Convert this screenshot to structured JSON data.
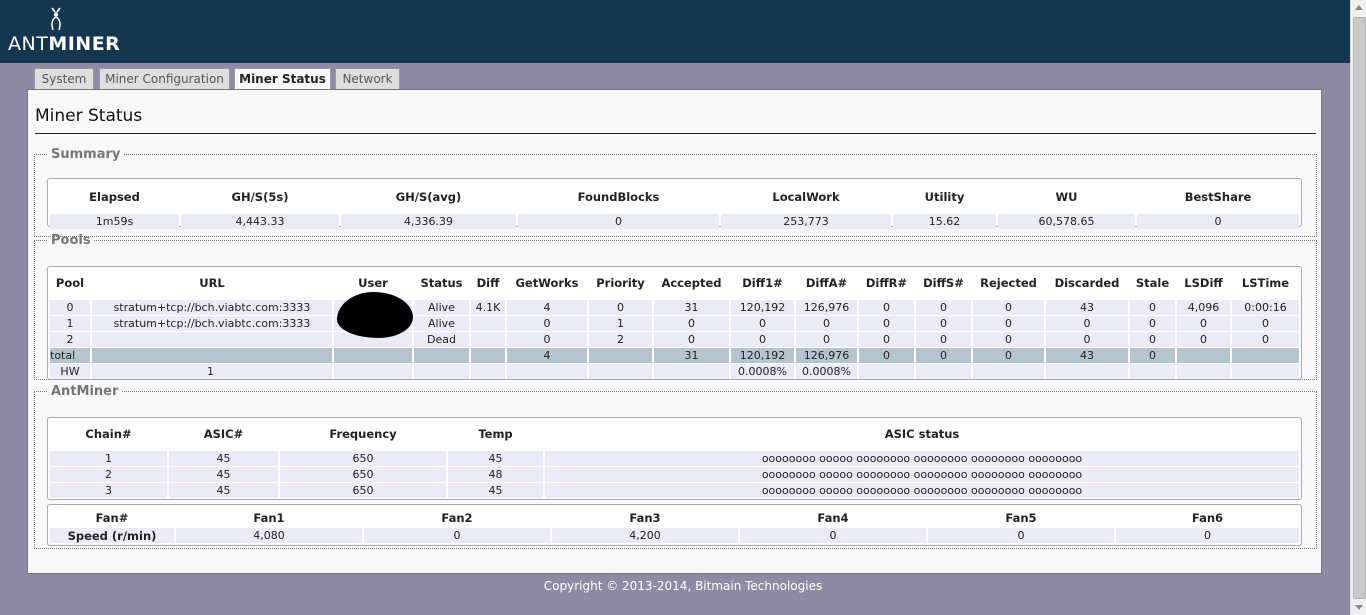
{
  "header": {
    "logo_light": "ANT",
    "logo_bold": "MINER"
  },
  "tabs": [
    {
      "label": "System",
      "active": false
    },
    {
      "label": "Miner Configuration",
      "active": false
    },
    {
      "label": "Miner Status",
      "active": true
    },
    {
      "label": "Network",
      "active": false
    }
  ],
  "page": {
    "title": "Miner Status"
  },
  "summary": {
    "legend": "Summary",
    "headers": [
      "Elapsed",
      "GH/S(5s)",
      "GH/S(avg)",
      "FoundBlocks",
      "LocalWork",
      "Utility",
      "WU",
      "BestShare"
    ],
    "row": [
      "1m59s",
      "4,443.33",
      "4,336.39",
      "0",
      "253,773",
      "15.62",
      "60,578.65",
      "0"
    ]
  },
  "pools": {
    "legend": "Pools",
    "headers": [
      "Pool",
      "URL",
      "User",
      "Status",
      "Diff",
      "GetWorks",
      "Priority",
      "Accepted",
      "Diff1#",
      "DiffA#",
      "DiffR#",
      "DiffS#",
      "Rejected",
      "Discarded",
      "Stale",
      "LSDiff",
      "LSTime"
    ],
    "rows": [
      [
        "0",
        "stratum+tcp://bch.viabtc.com:3333",
        "",
        "Alive",
        "4.1K",
        "4",
        "0",
        "31",
        "120,192",
        "126,976",
        "0",
        "0",
        "0",
        "43",
        "0",
        "4,096",
        "0:00:16"
      ],
      [
        "1",
        "stratum+tcp://bch.viabtc.com:3333",
        "",
        "Alive",
        "",
        "0",
        "1",
        "0",
        "0",
        "0",
        "0",
        "0",
        "0",
        "0",
        "0",
        "0",
        "0"
      ],
      [
        "2",
        "",
        "",
        "Dead",
        "",
        "0",
        "2",
        "0",
        "0",
        "0",
        "0",
        "0",
        "0",
        "0",
        "0",
        "0",
        "0"
      ],
      [
        "total",
        "",
        "",
        "",
        "",
        "4",
        "",
        "31",
        "120,192",
        "126,976",
        "0",
        "0",
        "0",
        "43",
        "0",
        "",
        ""
      ],
      [
        "HW",
        "1",
        "",
        "",
        "",
        "",
        "",
        "",
        "0.0008%",
        "0.0008%",
        "",
        "",
        "",
        "",
        "",
        "",
        ""
      ]
    ]
  },
  "antminer": {
    "legend": "AntMiner",
    "chain_headers": [
      "Chain#",
      "ASIC#",
      "Frequency",
      "Temp",
      "ASIC status"
    ],
    "chains": [
      [
        "1",
        "45",
        "650",
        "45",
        "oooooooo ooooo oooooooo oooooooo oooooooo oooooooo"
      ],
      [
        "2",
        "45",
        "650",
        "48",
        "oooooooo ooooo oooooooo oooooooo oooooooo oooooooo"
      ],
      [
        "3",
        "45",
        "650",
        "45",
        "oooooooo ooooo oooooooo oooooooo oooooooo oooooooo"
      ]
    ],
    "fan_headers": [
      "Fan#",
      "Fan1",
      "Fan2",
      "Fan3",
      "Fan4",
      "Fan5",
      "Fan6"
    ],
    "fan_row": [
      "Speed (r/min)",
      "4,080",
      "0",
      "4,200",
      "0",
      "0",
      "0"
    ]
  },
  "footer": {
    "text": "Copyright © 2013-2014, Bitmain Technologies"
  },
  "colors": {
    "header_bg": "#14364f",
    "page_bg": "#8f8aa3",
    "cell_bg": "#ebebf7",
    "total_bg": "#b4c5cf"
  },
  "icons": {
    "logo": "antminer-logo-icon"
  }
}
